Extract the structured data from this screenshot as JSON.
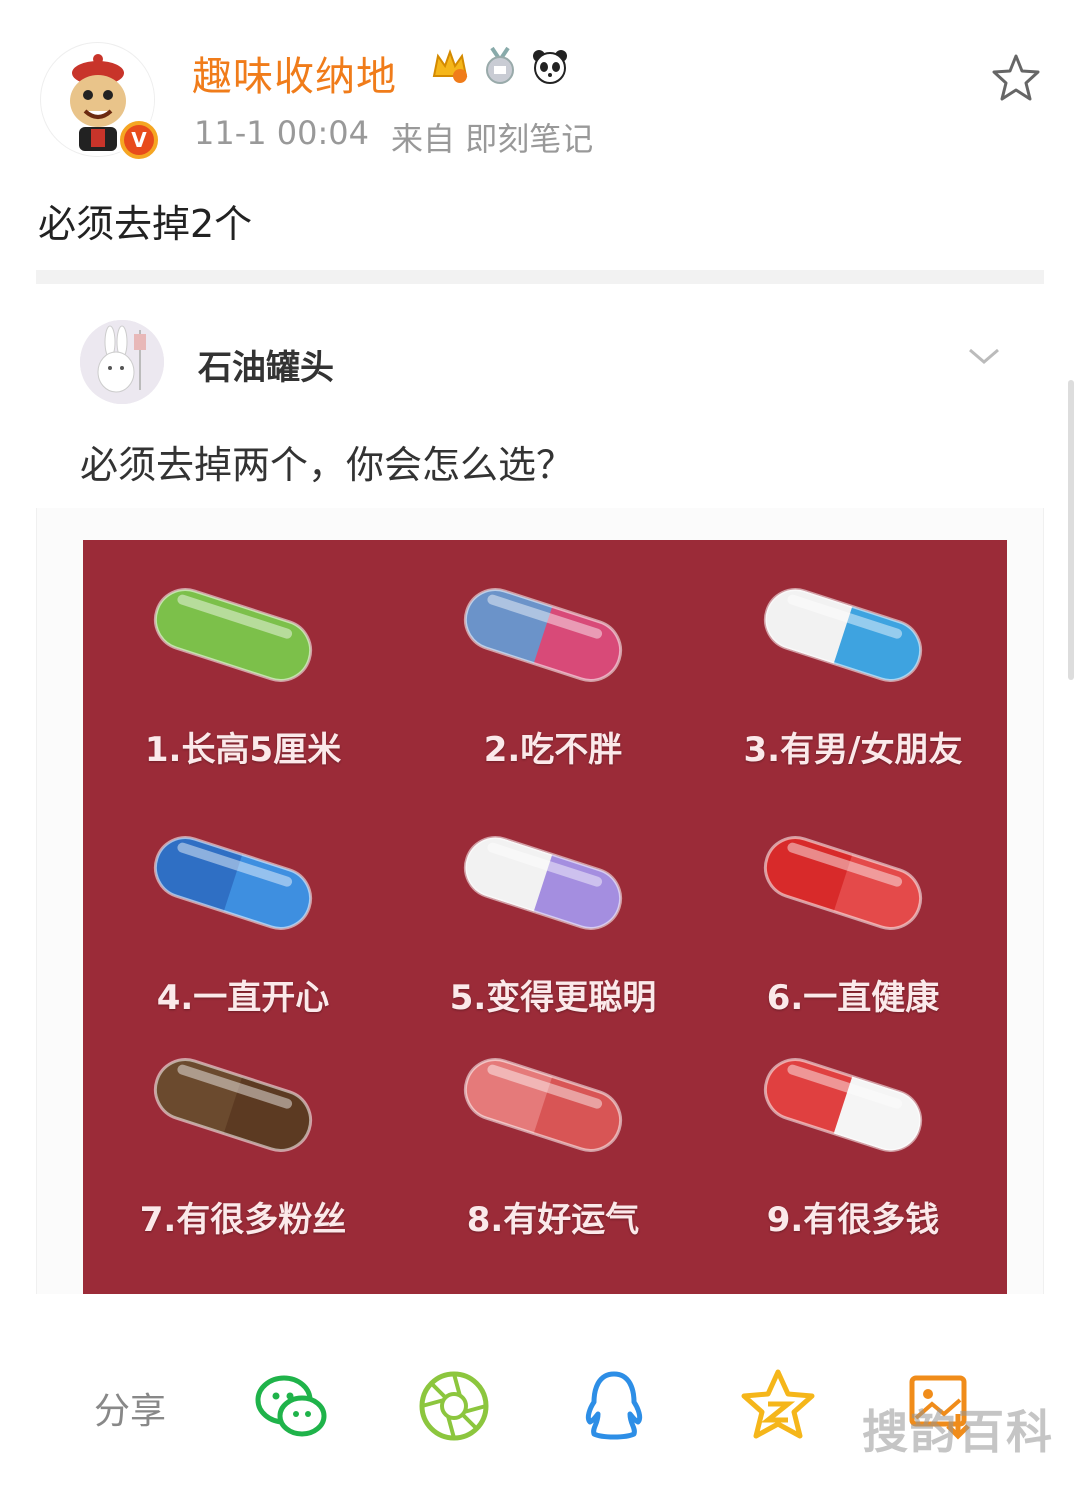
{
  "post": {
    "username": "趣味收纳地",
    "timestamp": "11-1 00:04",
    "source_prefix": "来自",
    "source": "即刻笔记",
    "text": "必须去掉2个",
    "verified_mark": "V"
  },
  "repost": {
    "username": "石油罐头",
    "text": "必须去掉两个，你会怎么选？",
    "pills": [
      {
        "label": "1.长高5厘米",
        "left": "#7cc04a",
        "right": "#7cc04a"
      },
      {
        "label": "2.吃不胖",
        "left": "#6b93c9",
        "right": "#d84a78"
      },
      {
        "label": "3.有男/女朋友",
        "left": "#f2f2f2",
        "right": "#3ea3e0"
      },
      {
        "label": "4.一直开心",
        "left": "#2f6fc4",
        "right": "#3e8fe0"
      },
      {
        "label": "5.变得更聪明",
        "left": "#f2f2f2",
        "right": "#a48ee0"
      },
      {
        "label": "6.一直健康",
        "left": "#d82a2a",
        "right": "#e44a4a"
      },
      {
        "label": "7.有很多粉丝",
        "left": "#6b4a2e",
        "right": "#5c3a22"
      },
      {
        "label": "8.有好运气",
        "left": "#e57a7a",
        "right": "#d85555"
      },
      {
        "label": "9.有很多钱",
        "left": "#e04040",
        "right": "#f5f5f5"
      }
    ]
  },
  "share": {
    "label": "分享",
    "targets": [
      "wechat-icon",
      "moments-icon",
      "qq-icon",
      "qzone-icon",
      "save-image-icon"
    ]
  },
  "watermark": "搜韵百科"
}
